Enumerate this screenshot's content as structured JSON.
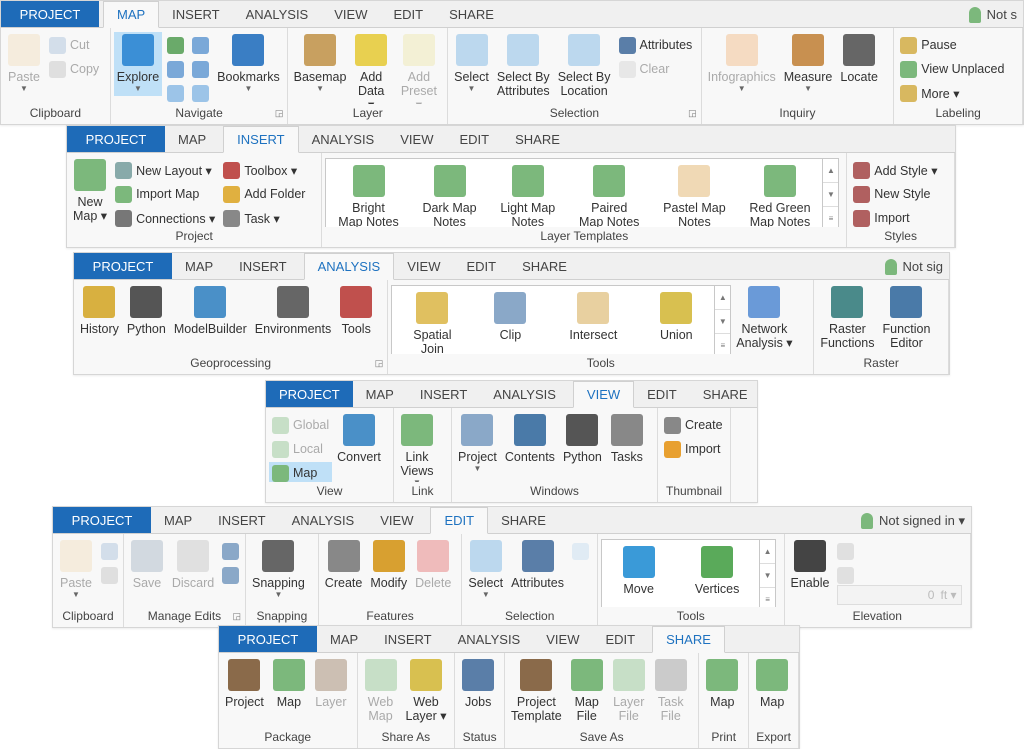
{
  "colors": {
    "project_tab": "#1e6bb8",
    "active_tab_text": "#1e72c0",
    "selected": "#bfe0f7"
  },
  "ribbons": [
    {
      "tabs": [
        "PROJECT",
        "MAP",
        "INSERT",
        "ANALYSIS",
        "VIEW",
        "EDIT",
        "SHARE"
      ],
      "active": 1,
      "account": "Not s",
      "groups": [
        {
          "label": "Clipboard",
          "columns": [
            [
              {
                "label": "Paste",
                "icon": "paste-icon",
                "size": "large",
                "disabled": true,
                "dropdown": true
              }
            ],
            [
              {
                "label": "Cut",
                "icon": "cut-icon",
                "disabled": true
              },
              {
                "label": "Copy",
                "icon": "copy-icon",
                "disabled": true
              }
            ]
          ]
        },
        {
          "label": "Navigate",
          "launcher": true,
          "columns": [
            [
              {
                "label": "Explore",
                "icon": "explore-icon",
                "size": "large",
                "selected": true,
                "dropdown": true
              }
            ],
            [
              {
                "label": "",
                "icon": "full-extent-globe-icon"
              },
              {
                "label": "",
                "icon": "fixed-zoom-in-icon"
              },
              {
                "label": "",
                "icon": "previous-extent-icon"
              }
            ],
            [
              {
                "label": "",
                "icon": "zoom-to-selected-icon"
              },
              {
                "label": "",
                "icon": "fixed-zoom-out-icon"
              },
              {
                "label": "",
                "icon": "next-extent-icon"
              }
            ],
            [
              {
                "label": "Bookmarks",
                "icon": "bookmarks-icon",
                "size": "large",
                "dropdown": true
              }
            ]
          ]
        },
        {
          "label": "Layer",
          "columns": [
            [
              {
                "label": "Basemap",
                "icon": "basemap-icon",
                "size": "large",
                "dropdown": true
              }
            ],
            [
              {
                "label": "Add\nData ▾",
                "icon": "add-data-icon",
                "size": "large"
              }
            ],
            [
              {
                "label": "Add\nPreset ▾",
                "icon": "add-preset-icon",
                "size": "large",
                "disabled": true
              }
            ]
          ]
        },
        {
          "label": "Selection",
          "launcher": true,
          "columns": [
            [
              {
                "label": "Select",
                "icon": "select-icon",
                "size": "large",
                "dropdown": true
              }
            ],
            [
              {
                "label": "Select By\nAttributes",
                "icon": "select-by-attributes-icon",
                "size": "large"
              }
            ],
            [
              {
                "label": "Select By\nLocation",
                "icon": "select-by-location-icon",
                "size": "large"
              }
            ],
            [
              {
                "label": "Attributes",
                "icon": "attributes-icon"
              },
              {
                "label": "Clear",
                "icon": "clear-icon",
                "disabled": true
              }
            ]
          ]
        },
        {
          "label": "Inquiry",
          "columns": [
            [
              {
                "label": "Infographics",
                "icon": "infographics-icon",
                "size": "large",
                "disabled": true,
                "dropdown": true
              }
            ],
            [
              {
                "label": "Measure",
                "icon": "measure-icon",
                "size": "large",
                "dropdown": true
              }
            ],
            [
              {
                "label": "Locate",
                "icon": "locate-binoculars-icon",
                "size": "large"
              }
            ]
          ]
        },
        {
          "label": "Labeling",
          "columns": [
            [
              {
                "label": "Pause",
                "icon": "pause-labels-icon"
              },
              {
                "label": "View Unplaced",
                "icon": "view-unplaced-icon"
              },
              {
                "label": "More ▾",
                "icon": "more-labels-icon"
              }
            ]
          ]
        }
      ]
    },
    {
      "tabs": [
        "PROJECT",
        "MAP",
        "INSERT",
        "ANALYSIS",
        "VIEW",
        "EDIT",
        "SHARE"
      ],
      "active": 2,
      "account": "",
      "groups": [
        {
          "label": "Project",
          "columns": [
            [
              {
                "label": "New\nMap ▾",
                "icon": "new-map-icon",
                "size": "large"
              }
            ],
            [
              {
                "label": "New Layout ▾",
                "icon": "new-layout-icon"
              },
              {
                "label": "Import Map",
                "icon": "import-map-icon"
              },
              {
                "label": "Connections ▾",
                "icon": "connections-icon"
              }
            ],
            [
              {
                "label": "Toolbox ▾",
                "icon": "toolbox-icon"
              },
              {
                "label": "Add Folder",
                "icon": "add-folder-icon"
              },
              {
                "label": "Task ▾",
                "icon": "task-icon"
              }
            ]
          ]
        },
        {
          "label": "Layer Templates",
          "gallery": [
            {
              "label": "Bright\nMap Notes",
              "icon": "bright-map-notes-icon"
            },
            {
              "label": "Dark Map\nNotes",
              "icon": "dark-map-notes-icon"
            },
            {
              "label": "Light Map\nNotes",
              "icon": "light-map-notes-icon"
            },
            {
              "label": "Paired\nMap Notes",
              "icon": "paired-map-notes-icon"
            },
            {
              "label": "Pastel Map\nNotes",
              "icon": "pastel-map-notes-icon"
            },
            {
              "label": "Red Green\nMap Notes",
              "icon": "red-green-map-notes-icon"
            }
          ],
          "columns": []
        },
        {
          "label": "Styles",
          "columns": [
            [
              {
                "label": "Add Style ▾",
                "icon": "add-style-icon"
              },
              {
                "label": "New Style",
                "icon": "new-style-icon"
              },
              {
                "label": "Import",
                "icon": "import-style-icon"
              }
            ]
          ]
        }
      ]
    },
    {
      "tabs": [
        "PROJECT",
        "MAP",
        "INSERT",
        "ANALYSIS",
        "VIEW",
        "EDIT",
        "SHARE"
      ],
      "active": 3,
      "account": "Not sig",
      "groups": [
        {
          "label": "Geoprocessing",
          "launcher": true,
          "columns": [
            [
              {
                "label": "History",
                "icon": "history-icon",
                "size": "large"
              }
            ],
            [
              {
                "label": "Python",
                "icon": "python-icon",
                "size": "large"
              }
            ],
            [
              {
                "label": "ModelBuilder",
                "icon": "modelbuilder-icon",
                "size": "large"
              }
            ],
            [
              {
                "label": "Environments",
                "icon": "environments-icon",
                "size": "large"
              }
            ],
            [
              {
                "label": "Tools",
                "icon": "tools-toolbox-icon",
                "size": "large"
              }
            ]
          ]
        },
        {
          "label": "Tools",
          "gallery": [
            {
              "label": "Spatial\nJoin",
              "icon": "spatial-join-icon"
            },
            {
              "label": "Clip",
              "icon": "clip-icon"
            },
            {
              "label": "Intersect",
              "icon": "intersect-icon"
            },
            {
              "label": "Union",
              "icon": "union-icon"
            }
          ],
          "columns": [
            [
              {
                "label": "Network\nAnalysis ▾",
                "icon": "network-analysis-icon",
                "size": "large"
              }
            ]
          ]
        },
        {
          "label": "Raster",
          "columns": [
            [
              {
                "label": "Raster\nFunctions",
                "icon": "raster-functions-icon",
                "size": "large"
              }
            ],
            [
              {
                "label": "Function\nEditor",
                "icon": "function-editor-icon",
                "size": "large"
              }
            ]
          ]
        }
      ]
    },
    {
      "tabs": [
        "PROJECT",
        "MAP",
        "INSERT",
        "ANALYSIS",
        "VIEW",
        "EDIT",
        "SHARE"
      ],
      "active": 4,
      "account": "",
      "groups": [
        {
          "label": "View",
          "columns": [
            [
              {
                "label": "Global",
                "icon": "global-view-icon",
                "disabled": true
              },
              {
                "label": "Local",
                "icon": "local-view-icon",
                "disabled": true
              },
              {
                "label": "Map",
                "icon": "map-view-icon",
                "selected": true
              }
            ],
            [
              {
                "label": "Convert",
                "icon": "convert-icon",
                "size": "large"
              }
            ]
          ]
        },
        {
          "label": "Link",
          "columns": [
            [
              {
                "label": "Link\nViews",
                "icon": "link-views-icon",
                "size": "large",
                "dropdown": true
              }
            ]
          ]
        },
        {
          "label": "Windows",
          "columns": [
            [
              {
                "label": "Project",
                "icon": "project-pane-icon",
                "size": "large",
                "dropdown": true
              }
            ],
            [
              {
                "label": "Contents",
                "icon": "contents-icon",
                "size": "large"
              }
            ],
            [
              {
                "label": "Python",
                "icon": "python-window-icon",
                "size": "large"
              }
            ],
            [
              {
                "label": "Tasks",
                "icon": "tasks-icon",
                "size": "large"
              }
            ]
          ]
        },
        {
          "label": "Thumbnail",
          "columns": [
            [
              {
                "label": "Create",
                "icon": "create-thumbnail-icon"
              },
              {
                "label": "Import",
                "icon": "import-thumbnail-icon"
              }
            ]
          ]
        }
      ]
    },
    {
      "tabs": [
        "PROJECT",
        "MAP",
        "INSERT",
        "ANALYSIS",
        "VIEW",
        "EDIT",
        "SHARE"
      ],
      "active": 5,
      "account": "Not signed in ▾",
      "groups": [
        {
          "label": "Clipboard",
          "columns": [
            [
              {
                "label": "Paste",
                "icon": "paste-icon",
                "size": "large",
                "disabled": true,
                "dropdown": true
              }
            ],
            [
              {
                "label": "",
                "icon": "cut-icon",
                "disabled": true
              },
              {
                "label": "",
                "icon": "copy-icon",
                "disabled": true
              }
            ]
          ]
        },
        {
          "label": "Manage Edits",
          "launcher": true,
          "columns": [
            [
              {
                "label": "Save",
                "icon": "save-edits-icon",
                "size": "large",
                "disabled": true
              }
            ],
            [
              {
                "label": "Discard",
                "icon": "discard-edits-icon",
                "size": "large",
                "disabled": true
              }
            ],
            [
              {
                "label": "",
                "icon": "edit-options-icon"
              },
              {
                "label": "",
                "icon": "edit-status-icon"
              }
            ]
          ]
        },
        {
          "label": "Snapping",
          "columns": [
            [
              {
                "label": "Snapping",
                "icon": "snapping-icon",
                "size": "large",
                "dropdown": true
              }
            ]
          ]
        },
        {
          "label": "Features",
          "columns": [
            [
              {
                "label": "Create",
                "icon": "create-features-icon",
                "size": "large"
              }
            ],
            [
              {
                "label": "Modify",
                "icon": "modify-features-icon",
                "size": "large"
              }
            ],
            [
              {
                "label": "Delete",
                "icon": "delete-icon",
                "size": "large",
                "disabled": true
              }
            ]
          ]
        },
        {
          "label": "Selection",
          "columns": [
            [
              {
                "label": "Select",
                "icon": "select-icon",
                "size": "large",
                "dropdown": true
              }
            ],
            [
              {
                "label": "Attributes",
                "icon": "attributes-icon",
                "size": "large"
              }
            ],
            [
              {
                "label": "",
                "icon": "clear-selection-icon",
                "disabled": true
              }
            ]
          ]
        },
        {
          "label": "Tools",
          "gallery": [
            {
              "label": "Move",
              "icon": "move-icon"
            },
            {
              "label": "Vertices",
              "icon": "vertices-icon"
            }
          ],
          "columns": []
        },
        {
          "label": "Elevation",
          "elevation": {
            "value": "0",
            "unit": "ft ▾"
          },
          "columns": [
            [
              {
                "label": "Enable",
                "icon": "enable-z-icon",
                "size": "large"
              }
            ],
            [
              {
                "label": "",
                "icon": "z-layer-icon",
                "disabled": true
              },
              {
                "label": "",
                "icon": "z-crosshair-icon",
                "disabled": true
              }
            ]
          ]
        }
      ]
    },
    {
      "tabs": [
        "PROJECT",
        "MAP",
        "INSERT",
        "ANALYSIS",
        "VIEW",
        "EDIT",
        "SHARE"
      ],
      "active": 6,
      "account": "",
      "groups": [
        {
          "label": "Package",
          "columns": [
            [
              {
                "label": "Project",
                "icon": "package-project-icon",
                "size": "large"
              }
            ],
            [
              {
                "label": "Map",
                "icon": "package-map-icon",
                "size": "large"
              }
            ],
            [
              {
                "label": "Layer",
                "icon": "package-layer-icon",
                "size": "large",
                "disabled": true
              }
            ]
          ]
        },
        {
          "label": "Share As",
          "columns": [
            [
              {
                "label": "Web\nMap",
                "icon": "web-map-icon",
                "size": "large",
                "disabled": true
              }
            ],
            [
              {
                "label": "Web\nLayer ▾",
                "icon": "web-layer-icon",
                "size": "large"
              }
            ]
          ]
        },
        {
          "label": "Status",
          "columns": [
            [
              {
                "label": "Jobs",
                "icon": "jobs-icon",
                "size": "large"
              }
            ]
          ]
        },
        {
          "label": "Save As",
          "columns": [
            [
              {
                "label": "Project\nTemplate",
                "icon": "project-template-icon",
                "size": "large"
              }
            ],
            [
              {
                "label": "Map\nFile",
                "icon": "map-file-icon",
                "size": "large"
              }
            ],
            [
              {
                "label": "Layer\nFile",
                "icon": "layer-file-icon",
                "size": "large",
                "disabled": true
              }
            ],
            [
              {
                "label": "Task\nFile",
                "icon": "task-file-icon",
                "size": "large",
                "disabled": true
              }
            ]
          ]
        },
        {
          "label": "Print",
          "columns": [
            [
              {
                "label": "Map",
                "icon": "print-map-icon",
                "size": "large"
              }
            ]
          ]
        },
        {
          "label": "Export",
          "columns": [
            [
              {
                "label": "Map",
                "icon": "export-map-icon",
                "size": "large"
              }
            ]
          ]
        }
      ]
    }
  ]
}
